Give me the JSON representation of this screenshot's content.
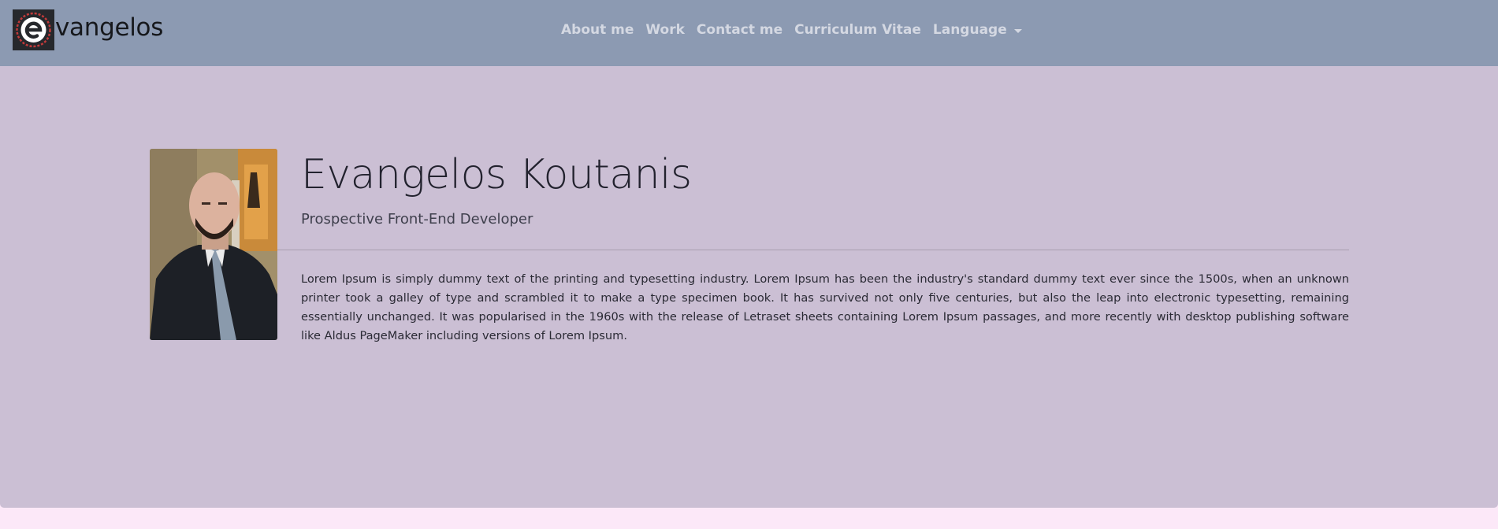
{
  "brand": {
    "logo_icon": "e-monogram-logo-icon",
    "text": "vangelos"
  },
  "nav": {
    "items": [
      {
        "label": "About me"
      },
      {
        "label": "Work"
      },
      {
        "label": "Contact me"
      },
      {
        "label": "Curriculum Vitae"
      }
    ],
    "language": {
      "label": "Language",
      "icon": "caret-down-icon"
    }
  },
  "profile": {
    "photo_icon": "profile-photo",
    "name": "Evangelos Koutanis",
    "subtitle": "Prospective Front-End Developer",
    "bio": "Lorem Ipsum is simply dummy text of the printing and typesetting industry. Lorem Ipsum has been the industry's standard dummy text ever since the 1500s, when an unknown printer took a galley of type and scrambled it to make a type specimen book. It has survived not only five centuries, but also the leap into electronic typesetting, remaining essentially unchanged. It was popularised in the 1960s with the release of Letraset sheets containing Lorem Ipsum passages, and more recently with desktop publishing software like Aldus PageMaker including versions of Lorem Ipsum."
  },
  "colors": {
    "navbar": "#8c9ab2",
    "nav_text": "#d4d8e2",
    "jumbotron": "#cbbfd4",
    "page": "#fce8f8"
  }
}
